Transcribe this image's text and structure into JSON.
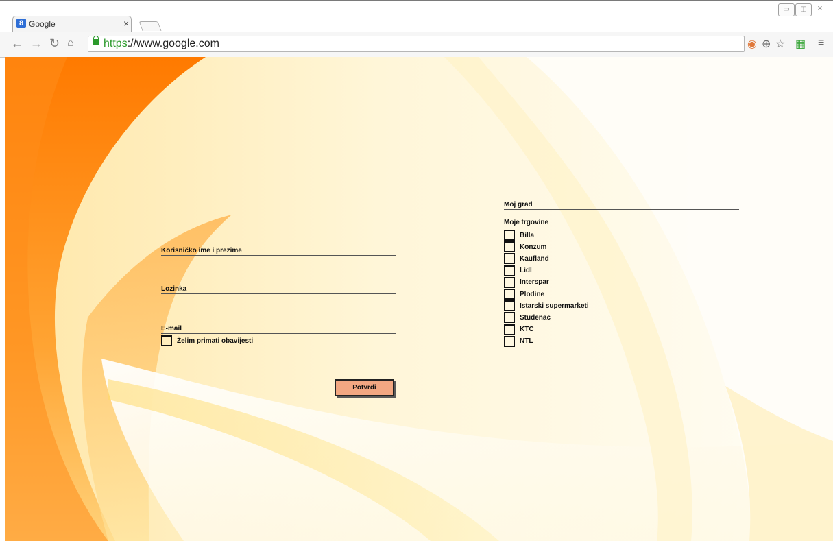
{
  "browser": {
    "tab_title": "Google",
    "tab_close": "×",
    "favicon_letter": "8",
    "url_scheme": "https",
    "url_rest": "://www.google.com",
    "window_controls": [
      "▭",
      "◫",
      "⨯"
    ]
  },
  "form": {
    "username_label": "Korisničko ime i prezime",
    "password_label": "Lozinka",
    "email_label": "E-mail",
    "notify_label": "Želim primati obavijesti",
    "submit_label": "Potvrdi"
  },
  "right_panel": {
    "city_label": "Moj grad",
    "stores_label": "Moje trgovine",
    "stores": [
      {
        "label": "Billa"
      },
      {
        "label": "Konzum"
      },
      {
        "label": "Kaufland"
      },
      {
        "label": "Lidl"
      },
      {
        "label": "Interspar"
      },
      {
        "label": "Plodine"
      },
      {
        "label": "Istarski supermarketi"
      },
      {
        "label": "Studenac"
      },
      {
        "label": "KTC"
      },
      {
        "label": "NTL"
      }
    ]
  },
  "colors": {
    "orange_dark": "#ff7a00",
    "orange_light": "#ffb347",
    "button_fill": "#f2a782",
    "secure_green": "#2c9a2c"
  }
}
